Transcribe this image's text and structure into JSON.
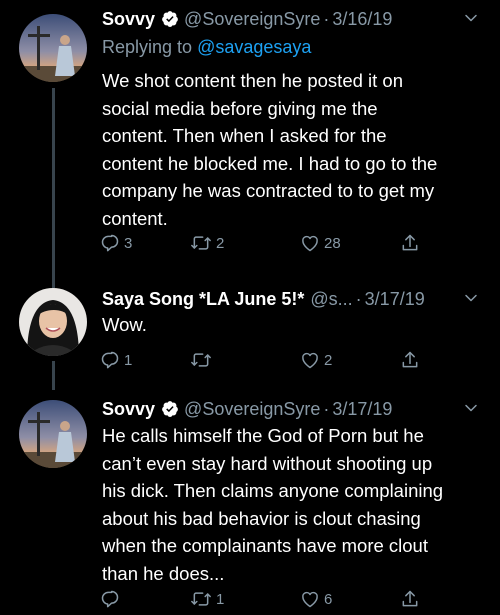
{
  "tweets": [
    {
      "name": "Sovvy",
      "handle": "@SovereignSyre",
      "separator": "·",
      "date": "3/16/19",
      "replying_prefix": "Replying to",
      "replying_to": "@savagesaya",
      "lines": [
        "We shot content then he posted it on",
        "social media before giving me the",
        "content. Then when I asked for the",
        "content he blocked me. I had to go to the",
        "company he was contracted to to get my",
        "content."
      ],
      "replies": "3",
      "retweets": "2",
      "likes": "28"
    },
    {
      "name": "Saya Song *LA June 5!*",
      "handle": "@s...",
      "separator": "·",
      "date": "3/17/19",
      "lines": [
        "Wow."
      ],
      "replies": "1",
      "retweets": "",
      "likes": "2"
    },
    {
      "name": "Sovvy",
      "handle": "@SovereignSyre",
      "separator": "·",
      "date": "3/17/19",
      "lines": [
        "He calls himself the God of Porn but he",
        "can’t even stay hard without shooting up",
        "his dick. Then claims anyone complaining",
        "about his bad behavior is clout chasing",
        "when the complainants have more clout",
        "than he does..."
      ],
      "replies": "",
      "retweets": "1",
      "likes": "6"
    }
  ],
  "icons": {
    "reply": "reply-icon",
    "retweet": "retweet-icon",
    "like": "heart-icon",
    "share": "share-icon",
    "verified": "verified-badge-icon",
    "menu": "chevron-down-icon"
  },
  "colors": {
    "background": "#000000",
    "text": "#ffffff",
    "secondary": "#8899a6",
    "link": "#1da1f2",
    "thread_line": "#38444d",
    "verified": "#ffffff"
  }
}
